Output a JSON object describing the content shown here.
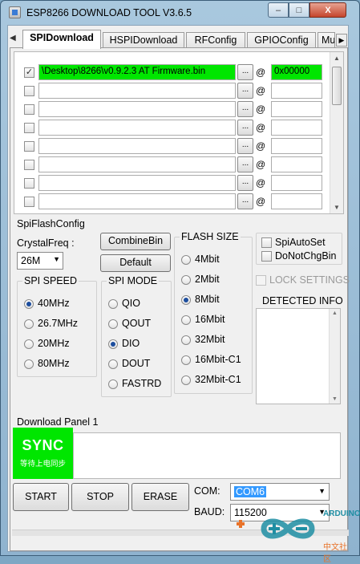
{
  "window": {
    "title": "ESP8266 DOWNLOAD TOOL V3.6.5",
    "minimize_label": "–",
    "maximize_label": "□",
    "close_label": "X"
  },
  "tabs": [
    "SPIDownload",
    "HSPIDownload",
    "RFConfig",
    "GPIOConfig",
    "Mu"
  ],
  "tab_arrow_left": "◀",
  "tab_arrow_right": "▶",
  "files": [
    {
      "checked": true,
      "path": "\\Desktop\\8266\\v0.9.2.3 AT Firmware.bin",
      "address": "0x00000"
    },
    {
      "checked": false,
      "path": "",
      "address": ""
    },
    {
      "checked": false,
      "path": "",
      "address": ""
    },
    {
      "checked": false,
      "path": "",
      "address": ""
    },
    {
      "checked": false,
      "path": "",
      "address": ""
    },
    {
      "checked": false,
      "path": "",
      "address": ""
    },
    {
      "checked": false,
      "path": "",
      "address": ""
    },
    {
      "checked": false,
      "path": "",
      "address": ""
    }
  ],
  "browse_label": "...",
  "at_symbol": "@",
  "checkmark": "✓",
  "spi_flash_config": {
    "label": "SpiFlashConfig",
    "crystal_label": "CrystalFreq :",
    "crystal_value": "26M",
    "combine_button": "CombineBin",
    "default_button": "Default",
    "spi_speed": {
      "title": "SPI SPEED",
      "options": [
        "40MHz",
        "26.7MHz",
        "20MHz",
        "80MHz"
      ],
      "selected": 0
    },
    "spi_mode": {
      "title": "SPI MODE",
      "options": [
        "QIO",
        "QOUT",
        "DIO",
        "DOUT",
        "FASTRD"
      ],
      "selected": 2
    },
    "flash_size": {
      "title": "FLASH SIZE",
      "options": [
        "4Mbit",
        "2Mbit",
        "8Mbit",
        "16Mbit",
        "32Mbit",
        "16Mbit-C1",
        "32Mbit-C1"
      ],
      "selected": 2
    },
    "spi_auto_set": "SpiAutoSet",
    "do_not_chg_bin": "DoNotChgBin",
    "lock_settings": "LOCK SETTINGS",
    "detected_info": "DETECTED INFO"
  },
  "download_panel": {
    "label": "Download Panel 1",
    "status": "SYNC",
    "status_sub": "等待上电同步",
    "start_button": "START",
    "stop_button": "STOP",
    "erase_button": "ERASE",
    "com_label": "COM:",
    "com_value": "COM6",
    "baud_label": "BAUD:",
    "baud_value": "115200"
  },
  "colors": {
    "accent_green": "#00e600",
    "selection_blue": "#3399ff",
    "radio_dot": "#1d4e9e"
  },
  "watermark": {
    "brand": "ARDUINO",
    "sub": "中文社区"
  }
}
